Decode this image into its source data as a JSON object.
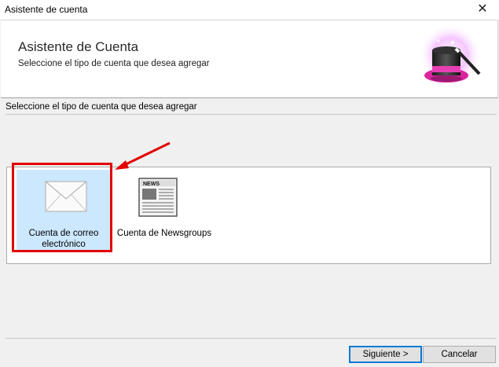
{
  "window": {
    "title": "Asistente de cuenta",
    "close_glyph": "✕"
  },
  "header": {
    "title": "Asistente de Cuenta",
    "subtitle": "Seleccione el tipo de cuenta que desea agregar",
    "icon": "magic-hat-icon"
  },
  "section_label": "Seleccione el tipo de cuenta que desea agregar",
  "account_types": [
    {
      "label": "Cuenta de correo electrónico",
      "icon": "envelope-icon",
      "selected": true
    },
    {
      "label": "Cuenta de Newsgroups",
      "icon": "newspaper-icon",
      "selected": false
    }
  ],
  "news_icon_text": "NEWS",
  "buttons": {
    "next": "Siguiente >",
    "cancel": "Cancelar"
  },
  "colors": {
    "selection": "#cce8ff",
    "annotation": "#e30000",
    "focus": "#0078d7"
  }
}
